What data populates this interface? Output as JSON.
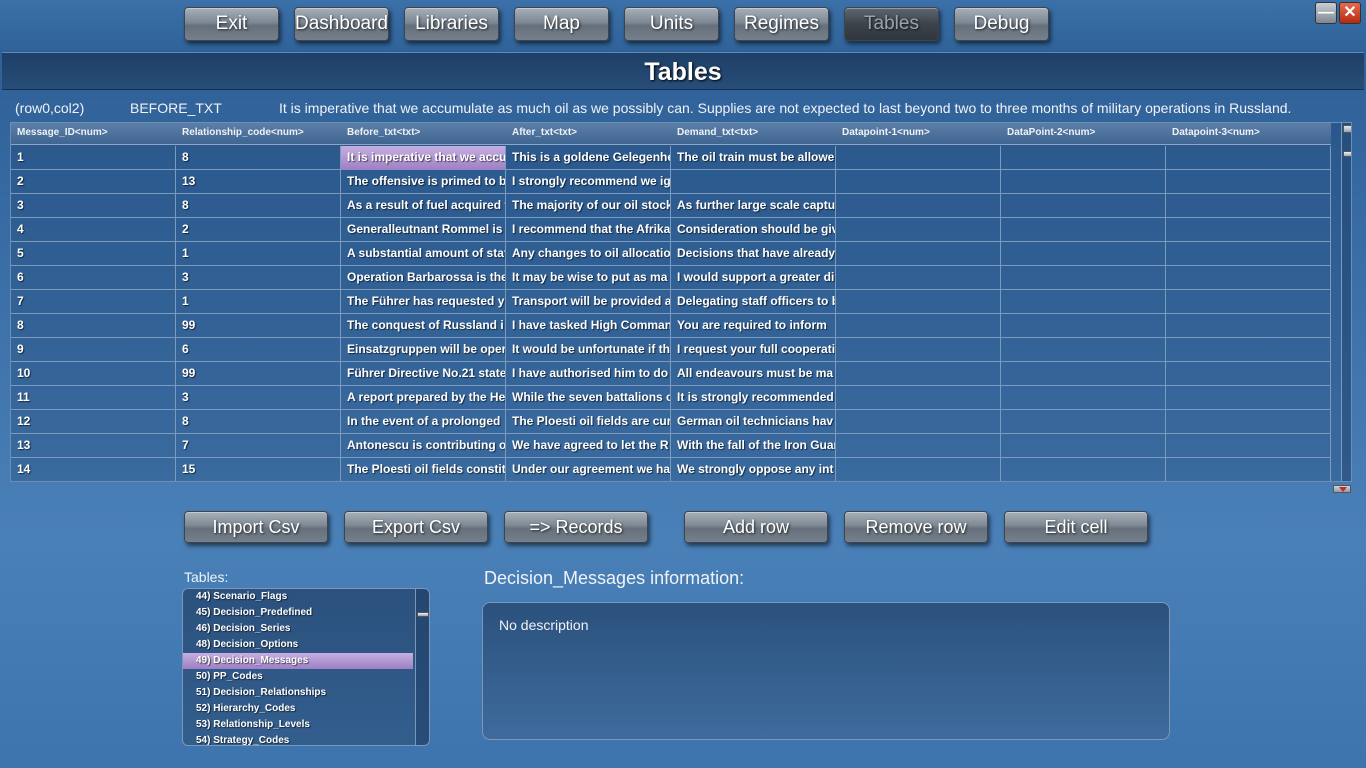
{
  "nav": {
    "exit": "Exit",
    "dashboard": "Dashboard",
    "libraries": "Libraries",
    "map": "Map",
    "units": "Units",
    "regimes": "Regimes",
    "tables": "Tables",
    "debug": "Debug"
  },
  "window": {
    "minimize": "—",
    "close": "✕"
  },
  "page_title": "Tables",
  "cell_info": {
    "position": "(row0,col2)",
    "column": "BEFORE_TXT",
    "value": "It is imperative that we accumulate as much oil as we possibly can. Supplies are not expected to last beyond two to three months of military operations in Russland."
  },
  "grid": {
    "columns": [
      "Message_ID<num>",
      "Relationship_code<num>",
      "Before_txt<txt>",
      "After_txt<txt>",
      "Demand_txt<txt>",
      "Datapoint-1<num>",
      "DataPoint-2<num>",
      "Datapoint-3<num>"
    ],
    "rows": [
      [
        "1",
        "8",
        "It is imperative that we accu",
        "This is a goldene Gelegenhe",
        "The oil train must be allowe",
        "",
        "",
        ""
      ],
      [
        "2",
        "13",
        "The offensive is primed to b",
        "I strongly recommend we ig",
        "",
        "",
        "",
        ""
      ],
      [
        "3",
        "8",
        "As a result of fuel acquired f",
        "The majority of our oil stock",
        "As further large scale captu",
        "",
        "",
        ""
      ],
      [
        "4",
        "2",
        "Generalleutnant Rommel is",
        "I recommend that the Afrika",
        "Consideration should be giv",
        "",
        "",
        ""
      ],
      [
        "5",
        "1",
        "A substantial amount of staf",
        "Any changes to oil allocatio",
        "Decisions that have already",
        "",
        "",
        ""
      ],
      [
        "6",
        "3",
        "Operation Barbarossa is the",
        "It may be wise to put as ma",
        "I would support a greater di",
        "",
        "",
        ""
      ],
      [
        "7",
        "1",
        "The Führer has requested y",
        "Transport will be provided a",
        "Delegating staff officers to b",
        "",
        "",
        ""
      ],
      [
        "8",
        "99",
        "The conquest of Russland i",
        "I have tasked High Comman",
        "You are required to inform",
        "",
        "",
        ""
      ],
      [
        "9",
        "6",
        "Einsatzgruppen will be oper",
        "It would be unfortunate if th",
        "I request your full cooperati",
        "",
        "",
        ""
      ],
      [
        "10",
        "99",
        "Führer Directive No.21 state",
        "I have authorised him to do",
        "All endeavours must be ma",
        "",
        "",
        ""
      ],
      [
        "11",
        "3",
        "A report prepared by the He",
        "While the seven battalions o",
        "It is strongly recommended",
        "",
        "",
        ""
      ],
      [
        "12",
        "8",
        "In the event of a prolonged",
        "The Ploesti oil fields are cur",
        "German oil technicians hav",
        "",
        "",
        ""
      ],
      [
        "13",
        "7",
        "Antonescu is contributing oi",
        "We have agreed to let the R",
        "With the fall of the Iron Guar",
        "",
        "",
        ""
      ],
      [
        "14",
        "15",
        "The Ploesti oil fields constit",
        "Under our agreement we ha",
        "We strongly oppose any int",
        "",
        "",
        ""
      ]
    ]
  },
  "actions": {
    "import_csv": "Import Csv",
    "export_csv": "Export Csv",
    "records": "=> Records",
    "add_row": "Add row",
    "remove_row": "Remove row",
    "edit_cell": "Edit cell"
  },
  "tables_list": {
    "label": "Tables:",
    "items": [
      "44) Scenario_Flags",
      "45) Decision_Predefined",
      "46) Decision_Series",
      "48) Decision_Options",
      "49) Decision_Messages",
      "50) PP_Codes",
      "51) Decision_Relationships",
      "52) Hierarchy_Codes",
      "53) Relationship_Levels",
      "54) Strategy_Codes"
    ],
    "selected": "49) Decision_Messages"
  },
  "info_panel": {
    "title": "Decision_Messages information:",
    "description": "No description"
  }
}
